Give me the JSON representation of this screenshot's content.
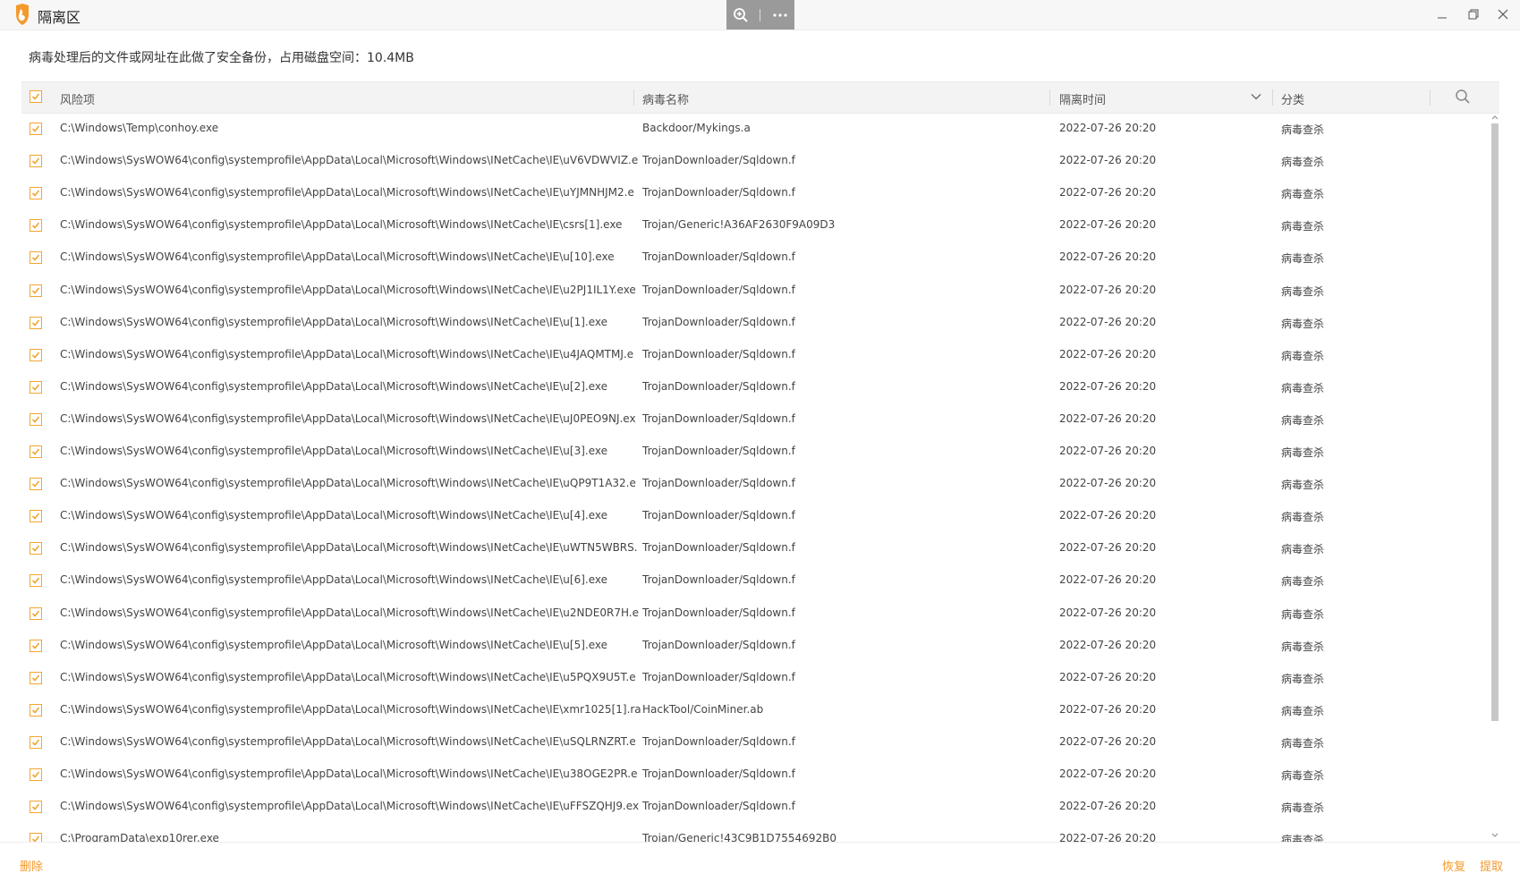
{
  "window": {
    "title": "隔离区"
  },
  "info": {
    "text": "病毒处理后的文件或网址在此做了安全备份，占用磁盘空间：",
    "size": "10.4MB"
  },
  "table": {
    "headers": {
      "risk": "风险项",
      "virus": "病毒名称",
      "time": "隔离时间",
      "category": "分类"
    },
    "rows": [
      {
        "path": "C:\\Windows\\Temp\\conhoy.exe",
        "virus": "Backdoor/Mykings.a",
        "time": "2022-07-26 20:20",
        "category": "病毒查杀"
      },
      {
        "path": "C:\\Windows\\SysWOW64\\config\\systemprofile\\AppData\\Local\\Microsoft\\Windows\\INetCache\\IE\\uV6VDWVIZ.e",
        "virus": "TrojanDownloader/Sqldown.f",
        "time": "2022-07-26 20:20",
        "category": "病毒查杀"
      },
      {
        "path": "C:\\Windows\\SysWOW64\\config\\systemprofile\\AppData\\Local\\Microsoft\\Windows\\INetCache\\IE\\uYJMNHJM2.e",
        "virus": "TrojanDownloader/Sqldown.f",
        "time": "2022-07-26 20:20",
        "category": "病毒查杀"
      },
      {
        "path": "C:\\Windows\\SysWOW64\\config\\systemprofile\\AppData\\Local\\Microsoft\\Windows\\INetCache\\IE\\csrs[1].exe",
        "virus": "Trojan/Generic!A36AF2630F9A09D3",
        "time": "2022-07-26 20:20",
        "category": "病毒查杀"
      },
      {
        "path": "C:\\Windows\\SysWOW64\\config\\systemprofile\\AppData\\Local\\Microsoft\\Windows\\INetCache\\IE\\u[10].exe",
        "virus": "TrojanDownloader/Sqldown.f",
        "time": "2022-07-26 20:20",
        "category": "病毒查杀"
      },
      {
        "path": "C:\\Windows\\SysWOW64\\config\\systemprofile\\AppData\\Local\\Microsoft\\Windows\\INetCache\\IE\\u2PJ1IL1Y.exe",
        "virus": "TrojanDownloader/Sqldown.f",
        "time": "2022-07-26 20:20",
        "category": "病毒查杀"
      },
      {
        "path": "C:\\Windows\\SysWOW64\\config\\systemprofile\\AppData\\Local\\Microsoft\\Windows\\INetCache\\IE\\u[1].exe",
        "virus": "TrojanDownloader/Sqldown.f",
        "time": "2022-07-26 20:20",
        "category": "病毒查杀"
      },
      {
        "path": "C:\\Windows\\SysWOW64\\config\\systemprofile\\AppData\\Local\\Microsoft\\Windows\\INetCache\\IE\\u4JAQMTMJ.e",
        "virus": "TrojanDownloader/Sqldown.f",
        "time": "2022-07-26 20:20",
        "category": "病毒查杀"
      },
      {
        "path": "C:\\Windows\\SysWOW64\\config\\systemprofile\\AppData\\Local\\Microsoft\\Windows\\INetCache\\IE\\u[2].exe",
        "virus": "TrojanDownloader/Sqldown.f",
        "time": "2022-07-26 20:20",
        "category": "病毒查杀"
      },
      {
        "path": "C:\\Windows\\SysWOW64\\config\\systemprofile\\AppData\\Local\\Microsoft\\Windows\\INetCache\\IE\\uJ0PEO9NJ.ex",
        "virus": "TrojanDownloader/Sqldown.f",
        "time": "2022-07-26 20:20",
        "category": "病毒查杀"
      },
      {
        "path": "C:\\Windows\\SysWOW64\\config\\systemprofile\\AppData\\Local\\Microsoft\\Windows\\INetCache\\IE\\u[3].exe",
        "virus": "TrojanDownloader/Sqldown.f",
        "time": "2022-07-26 20:20",
        "category": "病毒查杀"
      },
      {
        "path": "C:\\Windows\\SysWOW64\\config\\systemprofile\\AppData\\Local\\Microsoft\\Windows\\INetCache\\IE\\uQP9T1A32.e",
        "virus": "TrojanDownloader/Sqldown.f",
        "time": "2022-07-26 20:20",
        "category": "病毒查杀"
      },
      {
        "path": "C:\\Windows\\SysWOW64\\config\\systemprofile\\AppData\\Local\\Microsoft\\Windows\\INetCache\\IE\\u[4].exe",
        "virus": "TrojanDownloader/Sqldown.f",
        "time": "2022-07-26 20:20",
        "category": "病毒查杀"
      },
      {
        "path": "C:\\Windows\\SysWOW64\\config\\systemprofile\\AppData\\Local\\Microsoft\\Windows\\INetCache\\IE\\uWTN5WBRS.",
        "virus": "TrojanDownloader/Sqldown.f",
        "time": "2022-07-26 20:20",
        "category": "病毒查杀"
      },
      {
        "path": "C:\\Windows\\SysWOW64\\config\\systemprofile\\AppData\\Local\\Microsoft\\Windows\\INetCache\\IE\\u[6].exe",
        "virus": "TrojanDownloader/Sqldown.f",
        "time": "2022-07-26 20:20",
        "category": "病毒查杀"
      },
      {
        "path": "C:\\Windows\\SysWOW64\\config\\systemprofile\\AppData\\Local\\Microsoft\\Windows\\INetCache\\IE\\u2NDE0R7H.e",
        "virus": "TrojanDownloader/Sqldown.f",
        "time": "2022-07-26 20:20",
        "category": "病毒查杀"
      },
      {
        "path": "C:\\Windows\\SysWOW64\\config\\systemprofile\\AppData\\Local\\Microsoft\\Windows\\INetCache\\IE\\u[5].exe",
        "virus": "TrojanDownloader/Sqldown.f",
        "time": "2022-07-26 20:20",
        "category": "病毒查杀"
      },
      {
        "path": "C:\\Windows\\SysWOW64\\config\\systemprofile\\AppData\\Local\\Microsoft\\Windows\\INetCache\\IE\\u5PQX9U5T.e",
        "virus": "TrojanDownloader/Sqldown.f",
        "time": "2022-07-26 20:20",
        "category": "病毒查杀"
      },
      {
        "path": "C:\\Windows\\SysWOW64\\config\\systemprofile\\AppData\\Local\\Microsoft\\Windows\\INetCache\\IE\\xmr1025[1].ra",
        "virus": "HackTool/CoinMiner.ab",
        "time": "2022-07-26 20:20",
        "category": "病毒查杀"
      },
      {
        "path": "C:\\Windows\\SysWOW64\\config\\systemprofile\\AppData\\Local\\Microsoft\\Windows\\INetCache\\IE\\uSQLRNZRT.e",
        "virus": "TrojanDownloader/Sqldown.f",
        "time": "2022-07-26 20:20",
        "category": "病毒查杀"
      },
      {
        "path": "C:\\Windows\\SysWOW64\\config\\systemprofile\\AppData\\Local\\Microsoft\\Windows\\INetCache\\IE\\u38OGE2PR.e",
        "virus": "TrojanDownloader/Sqldown.f",
        "time": "2022-07-26 20:20",
        "category": "病毒查杀"
      },
      {
        "path": "C:\\Windows\\SysWOW64\\config\\systemprofile\\AppData\\Local\\Microsoft\\Windows\\INetCache\\IE\\uFFSZQHJ9.ex",
        "virus": "TrojanDownloader/Sqldown.f",
        "time": "2022-07-26 20:20",
        "category": "病毒查杀"
      },
      {
        "path": "C:\\ProgramData\\exp10rer.exe",
        "virus": "Trojan/Generic!43C9B1D7554692B0",
        "time": "2022-07-26 20:20",
        "category": "病毒查杀"
      }
    ]
  },
  "footer": {
    "delete": "删除",
    "restore": "恢复",
    "extract": "提取"
  },
  "colors": {
    "accent": "#f39a2c",
    "checkbox": "#f3a531",
    "toolbar": "#9a9a9a"
  },
  "icons": [
    "app-logo-icon",
    "zoom-icon",
    "more-icon",
    "minimize-icon",
    "maximize-icon",
    "close-icon",
    "checkbox-icon",
    "sort-chevron-icon",
    "search-icon"
  ]
}
